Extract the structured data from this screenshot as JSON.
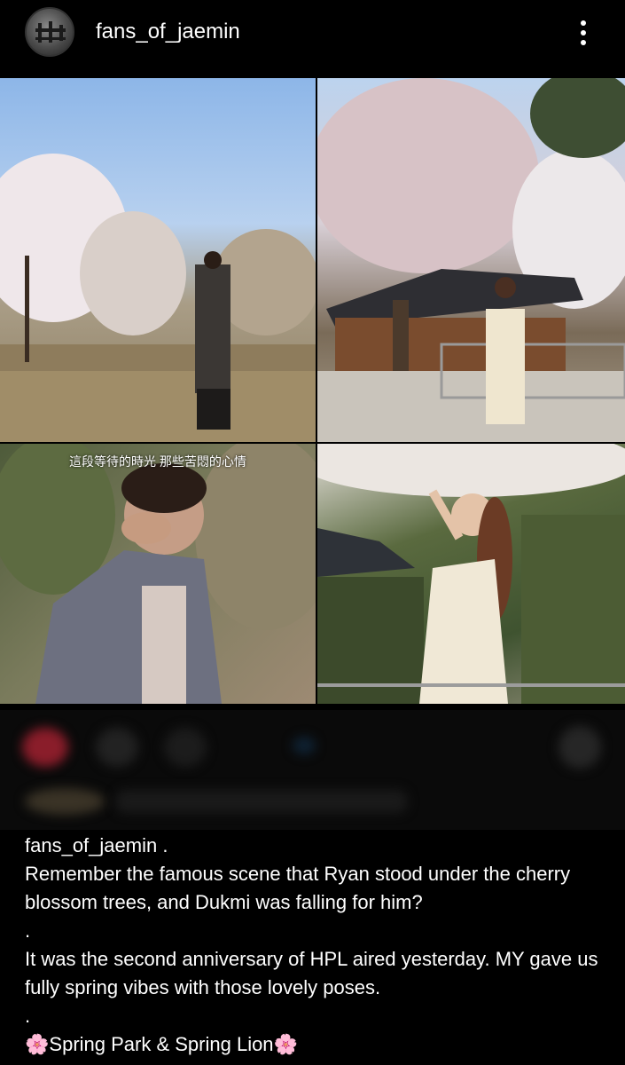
{
  "header": {
    "username": "fans_of_jaemin",
    "more_icon": "more-vertical-icon"
  },
  "grid": {
    "subtitle_text": "這段等待的時光 那些苦悶的心情"
  },
  "caption": {
    "username": "fans_of_jaemin",
    "username_suffix": " .",
    "line1": "Remember the famous scene that Ryan stood under the cherry blossom trees, and Dukmi was falling for him?",
    "dot1": ".",
    "line2": "It was the second anniversary of HPL aired yesterday. MY gave us fully spring vibes with those lovely poses.",
    "dot2": ".",
    "line3_text": "Spring Park & Spring Lion",
    "flower_emoji": "🌸"
  },
  "colors": {
    "background": "#000000",
    "text": "#ffffff"
  }
}
